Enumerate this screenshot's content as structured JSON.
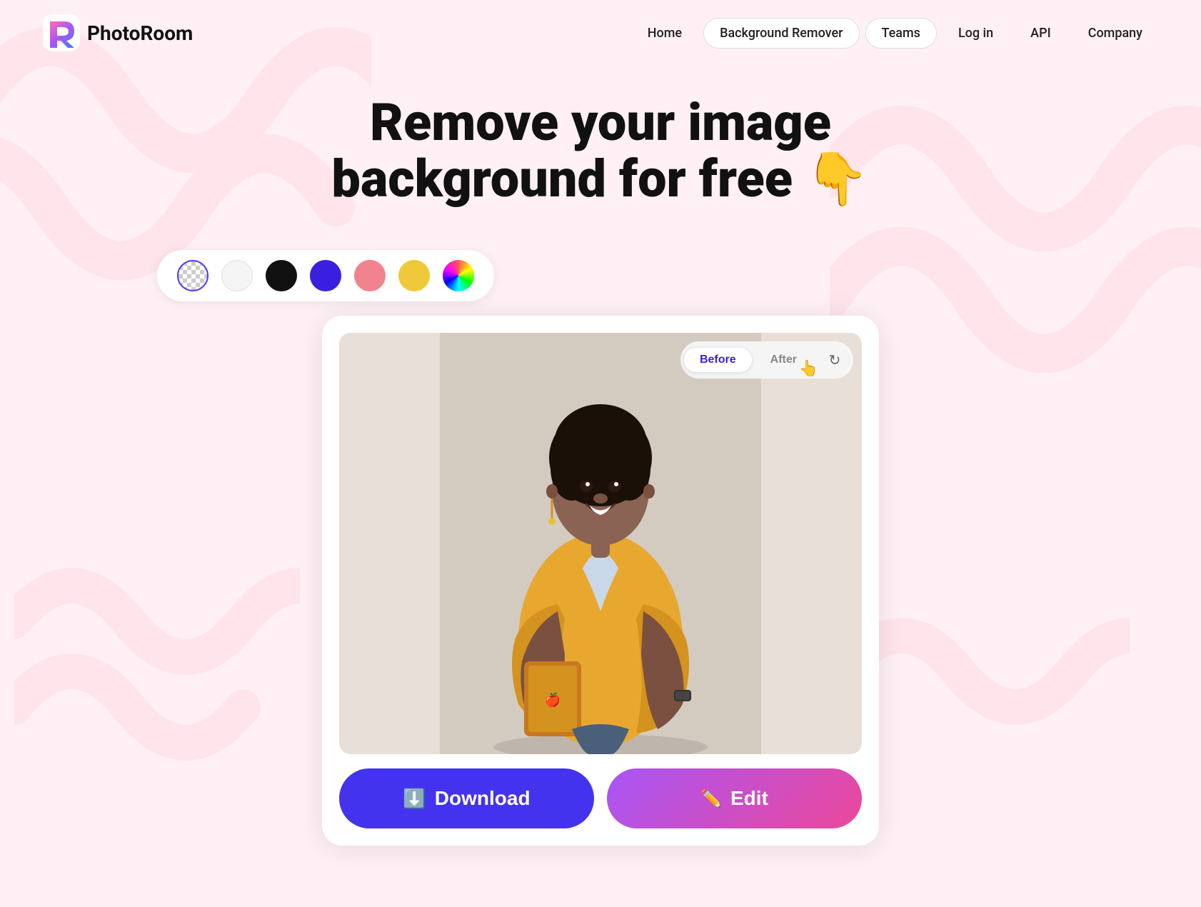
{
  "meta": {
    "title": "PhotoRoom - Remove your image background for free"
  },
  "nav": {
    "logo_text": "PhotoRoom",
    "links": [
      {
        "label": "Home",
        "id": "home",
        "pill": false
      },
      {
        "label": "Background Remover",
        "id": "bg-remover",
        "pill": true
      },
      {
        "label": "Teams",
        "id": "teams",
        "pill": true
      },
      {
        "label": "Log in",
        "id": "login",
        "pill": false
      },
      {
        "label": "API",
        "id": "api",
        "pill": false
      },
      {
        "label": "Company",
        "id": "company",
        "pill": false
      }
    ]
  },
  "hero": {
    "title_line1": "Remove your image",
    "title_line2": "background for free",
    "emoji": "👇"
  },
  "color_swatches": [
    {
      "id": "transparent",
      "label": "Transparent background",
      "type": "transparent"
    },
    {
      "id": "white",
      "label": "White background",
      "type": "white"
    },
    {
      "id": "black",
      "label": "Black background",
      "type": "black"
    },
    {
      "id": "purple",
      "label": "Purple background",
      "type": "purple"
    },
    {
      "id": "pink",
      "label": "Pink background",
      "type": "pink"
    },
    {
      "id": "yellow",
      "label": "Yellow background",
      "type": "yellow"
    },
    {
      "id": "multi",
      "label": "More colors",
      "type": "multi"
    }
  ],
  "editor": {
    "view_toggle": {
      "before_label": "Before",
      "after_label": "After",
      "active": "before"
    },
    "refresh_icon": "↻"
  },
  "actions": {
    "download_label": "Download",
    "edit_label": "Edit",
    "download_icon": "⬇",
    "edit_icon": "✏"
  },
  "colors": {
    "brand_purple": "#4433ee",
    "brand_gradient_start": "#a855f7",
    "brand_gradient_end": "#ec4899",
    "active_toggle": "#3a1fe0",
    "swatch_selected_border": "#5533ff"
  }
}
